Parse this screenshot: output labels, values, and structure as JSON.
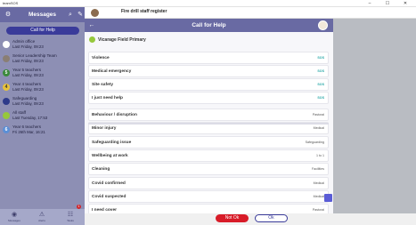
{
  "window": {
    "title": "teamSOS",
    "minimize": "–",
    "maximize": "☐",
    "close": "✕"
  },
  "sidebar": {
    "title": "Messages",
    "menu_icon": "⚙",
    "search_icon": "⌕",
    "compose_icon": "✎",
    "call_for_help": "Call for Help",
    "messages": [
      {
        "name": "Admin office",
        "date": "Last Friday, 09:23",
        "initial": "",
        "color": "#ffffff",
        "text_color": "#696aa3"
      },
      {
        "name": "Senior Leadership Team",
        "date": "Last Friday, 09:23",
        "initial": "",
        "color": "#8a7e74",
        "text_color": "#fff"
      },
      {
        "name": "Year 5 teachers",
        "date": "Last Friday, 09:23",
        "initial": "5",
        "color": "#3b8a3b",
        "text_color": "#fff"
      },
      {
        "name": "Year 4 teachers",
        "date": "Last Friday, 09:23",
        "initial": "4",
        "color": "#e8c23a",
        "text_color": "#333"
      },
      {
        "name": "Safeguarding",
        "date": "Last Friday, 09:23",
        "initial": "",
        "color": "#2d3a8a",
        "text_color": "#fff"
      },
      {
        "name": "All staff",
        "date": "Last Tuesday, 17:53",
        "initial": "",
        "color": "#96c83c",
        "text_color": "#fff"
      },
      {
        "name": "Year 6 teachers",
        "date": "Fri 26th Mar, 16:21",
        "initial": "6",
        "color": "#5b8fd6",
        "text_color": "#fff"
      }
    ],
    "nav": [
      {
        "icon": "◉",
        "label": "Messages"
      },
      {
        "icon": "⚠",
        "label": "Alerts"
      },
      {
        "icon": "☷",
        "label": "Tasks"
      }
    ],
    "badge": "1"
  },
  "conversation": {
    "title": "Fire drill staff register"
  },
  "modal": {
    "back_icon": "←",
    "title": "Call for Help",
    "school": "Vicarage Field Primary",
    "urgent": [
      {
        "label": "Violence",
        "tag": "SOS"
      },
      {
        "label": "Medical emergency",
        "tag": "SOS"
      },
      {
        "label": "Site safety",
        "tag": "SOS"
      },
      {
        "label": "I just need help",
        "tag": "SOS"
      }
    ],
    "other": [
      {
        "label": "Behaviour / disruption",
        "tag": "Pastoral"
      },
      {
        "label": "Minor injury",
        "tag": "Medical"
      },
      {
        "label": "Safeguarding issue",
        "tag": "Safeguarding"
      },
      {
        "label": "Wellbeing at work",
        "tag": "1 to 1"
      },
      {
        "label": "Cleaning",
        "tag": "Facilities"
      },
      {
        "label": "Covid confirmed",
        "tag": "Medical"
      },
      {
        "label": "Covid suspected",
        "tag": "Medical"
      },
      {
        "label": "I need cover",
        "tag": "Pastoral"
      }
    ]
  },
  "actions": {
    "not_ok": "Not Ok",
    "ok": "Ok"
  }
}
